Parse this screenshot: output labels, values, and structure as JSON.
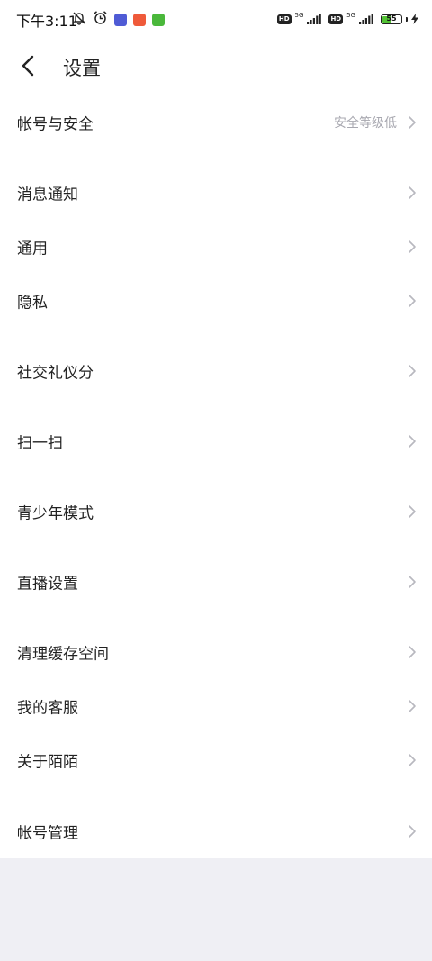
{
  "status_bar": {
    "time": "下午3:11",
    "left_icons": [
      "mute-bell-icon",
      "alarm-icon",
      "app-notification-icon",
      "app-notification-icon",
      "app-notification-icon"
    ],
    "hd1": "HD",
    "net1": "5G",
    "hd2": "HD",
    "net2": "5G",
    "battery_level": 55,
    "battery_text": "55",
    "charging": true
  },
  "header": {
    "title": "设置"
  },
  "menu": {
    "items": [
      {
        "label": "帐号与安全",
        "hint": "安全等级低"
      },
      {
        "label": "消息通知"
      },
      {
        "label": "通用"
      },
      {
        "label": "隐私"
      },
      {
        "label": "社交礼仪分"
      },
      {
        "label": "扫一扫"
      },
      {
        "label": "青少年模式"
      },
      {
        "label": "直播设置"
      },
      {
        "label": "清理缓存空间"
      },
      {
        "label": "我的客服"
      },
      {
        "label": "关于陌陌"
      },
      {
        "label": "帐号管理"
      }
    ]
  },
  "colors": {
    "battery_fill": "#52c234",
    "footer_background": "#efeff4",
    "hint_text": "#a8a8b0"
  }
}
